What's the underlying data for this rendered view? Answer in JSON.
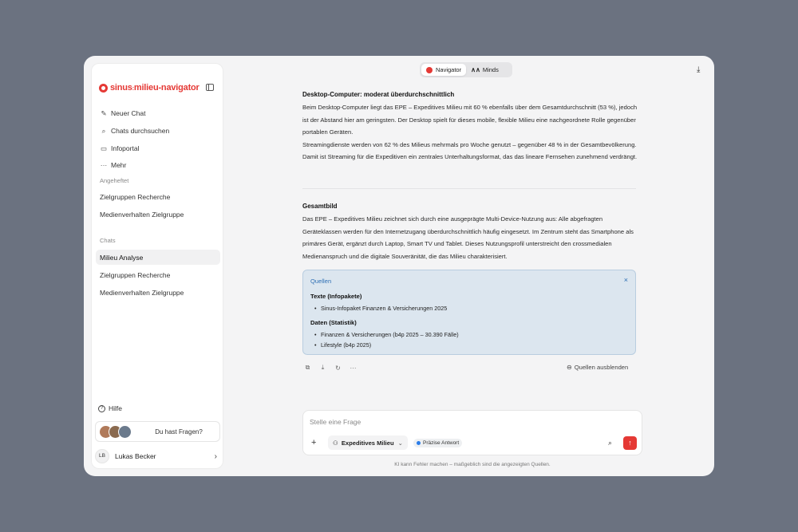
{
  "sidebar": {
    "brand_prefix": "sinus",
    "brand_suffix": "milieu-navigator",
    "nav": [
      {
        "label": "Neuer Chat",
        "icon": "edit-icon"
      },
      {
        "label": "Chats durchsuchen",
        "icon": "search-icon"
      },
      {
        "label": "Infoportal",
        "icon": "portal-icon"
      },
      {
        "label": "Mehr",
        "icon": "more-icon"
      }
    ],
    "pinned_label": "Angeheftet",
    "pinned": [
      "Zielgruppen Recherche",
      "Medienverhalten Zielgruppe"
    ],
    "chats_label": "Chats",
    "chats": [
      "Milieu Analyse",
      "Zielgruppen Recherche",
      "Medienverhalten Zielgruppe"
    ],
    "help_label": "Hilfe",
    "questions_label": "Du hast Fragen?",
    "user_initials": "LB",
    "user_name": "Lukas Becker"
  },
  "header": {
    "mode_navigator": "Navigator",
    "mode_minds": "Minds"
  },
  "content": {
    "section1_title": "Desktop-Computer: moderat überdurchschnittlich",
    "section1_p1": "Beim Desktop-Computer liegt das EPE – Expeditives Milieu mit 60 % ebenfalls über dem Gesamtdurchschnitt (53 %), jedoch ist der Abstand hier am geringsten. Der Desktop spielt für dieses mobile, flexible Milieu eine nachgeordnete Rolle gegenüber portablen Geräten.",
    "section1_p2": "Streamingdienste werden von 62 % des Milieus mehrmals pro Woche genutzt – gegenüber 48 % in der Gesamtbevölkerung. Damit ist Streaming für die Expeditiven ein zentrales Unterhaltungsformat, das das lineare Fernsehen zunehmend verdrängt.",
    "section2_title": "Gesamtbild",
    "section2_p1": "Das EPE – Expeditives Milieu zeichnet sich durch eine ausgeprägte Multi-Device-Nutzung aus: Alle abgefragten Geräteklassen werden für den Internetzugang überdurchschnittlich häufig eingesetzt. Im Zentrum steht das Smartphone als primäres Gerät, ergänzt durch Laptop, Smart TV und Tablet. Dieses Nutzungsprofil unterstreicht den crossmedialen Medienanspruch und die digitale Souveränität, die das Milieu charakterisiert."
  },
  "sources": {
    "title": "Quellen",
    "close": "×",
    "group1_title": "Texte (Infopakete)",
    "group1_items": [
      "Sinus-Infopaket Finanzen & Versicherungen 2025"
    ],
    "group2_title": "Daten (Statistik)",
    "group2_items": [
      "Finanzen & Versicherungen (b4p 2025 – 30.390 Fälle)",
      "Lifestyle (b4p 2025)"
    ],
    "hide_label": "Quellen ausblenden"
  },
  "composer": {
    "placeholder": "Stelle eine Frage",
    "milieu": "Expeditives Milieu",
    "badge": "Präzise Antwort",
    "disclaimer": "KI kann Fehler machen – maßgeblich sind die angezeigten Quellen."
  },
  "colors": {
    "accent": "#e53935",
    "sources_bg": "#dce6ef",
    "sources_text": "#2e6fb4"
  }
}
